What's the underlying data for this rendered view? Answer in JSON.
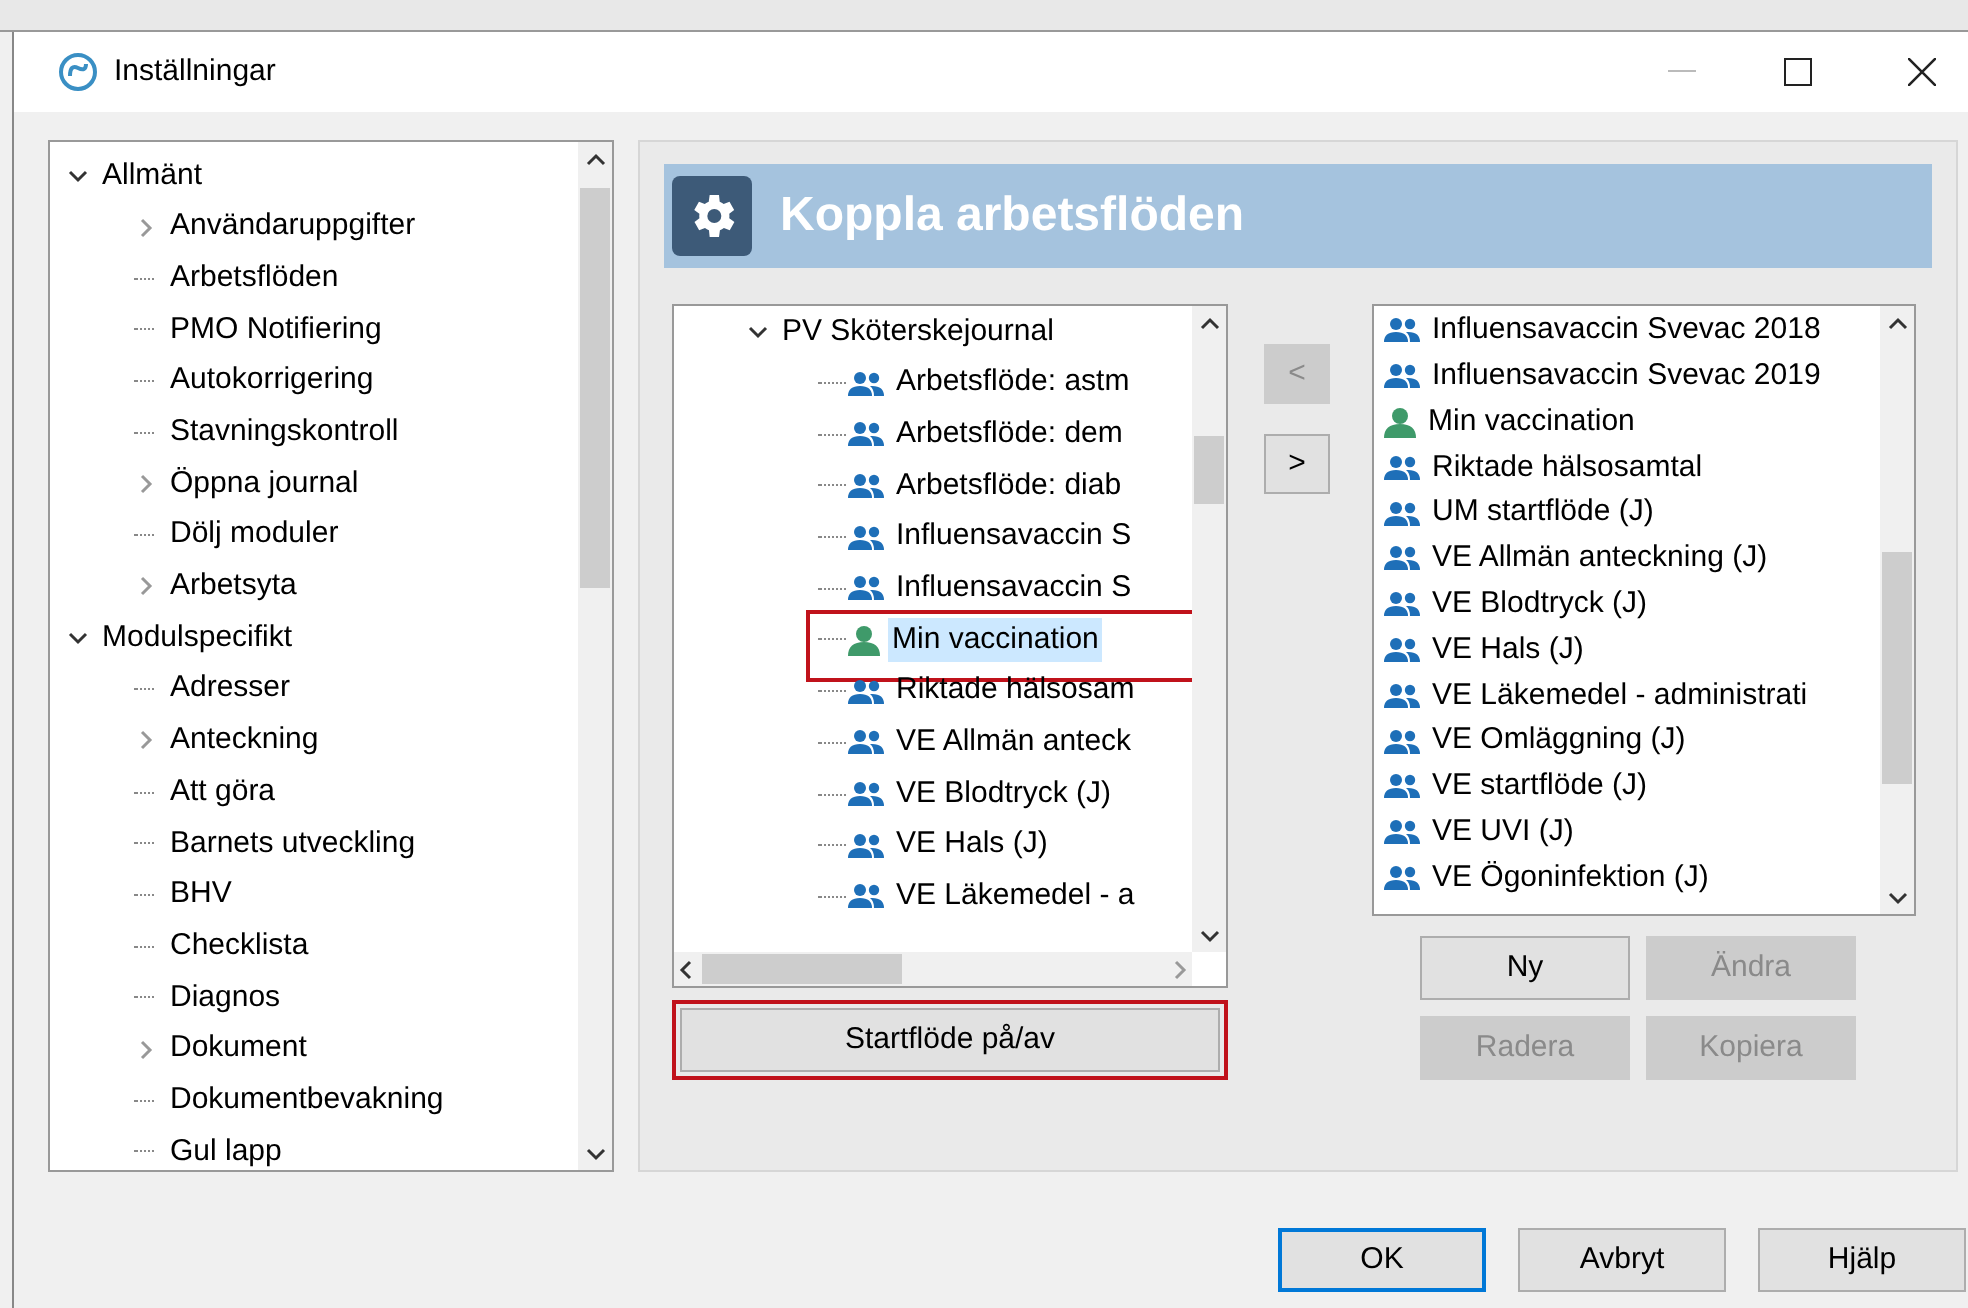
{
  "window": {
    "title": "Inställningar"
  },
  "nav_tree": [
    {
      "label": "Allmänt",
      "expanded": true,
      "children": [
        {
          "label": "Användaruppgifter",
          "expandable": true
        },
        {
          "label": "Arbetsflöden",
          "expandable": false
        },
        {
          "label": "PMO Notifiering",
          "expandable": false
        },
        {
          "label": "Autokorrigering",
          "expandable": false
        },
        {
          "label": "Stavningskontroll",
          "expandable": false
        },
        {
          "label": "Öppna journal",
          "expandable": true
        },
        {
          "label": "Dölj moduler",
          "expandable": false
        },
        {
          "label": "Arbetsyta",
          "expandable": true
        }
      ]
    },
    {
      "label": "Modulspecifikt",
      "expanded": true,
      "children": [
        {
          "label": "Adresser",
          "expandable": false
        },
        {
          "label": "Anteckning",
          "expandable": true
        },
        {
          "label": "Att göra",
          "expandable": false
        },
        {
          "label": "Barnets utveckling",
          "expandable": false
        },
        {
          "label": "BHV",
          "expandable": false
        },
        {
          "label": "Checklista",
          "expandable": false
        },
        {
          "label": "Diagnos",
          "expandable": false
        },
        {
          "label": "Dokument",
          "expandable": true
        },
        {
          "label": "Dokumentbevakning",
          "expandable": false
        },
        {
          "label": "Gul lapp",
          "expandable": false
        }
      ]
    }
  ],
  "panel": {
    "title": "Koppla arbetsflöden",
    "workflow_tree": {
      "label": "PV Sköterskejournal",
      "expanded": true,
      "children": [
        {
          "label": "Arbetsflöde: astm",
          "kind": "group",
          "selected": false,
          "highlighted": false
        },
        {
          "label": "Arbetsflöde: dem",
          "kind": "group",
          "selected": false,
          "highlighted": false
        },
        {
          "label": "Arbetsflöde: diab",
          "kind": "group",
          "selected": false,
          "highlighted": false
        },
        {
          "label": "Influensavaccin S",
          "kind": "group",
          "selected": false,
          "highlighted": false
        },
        {
          "label": "Influensavaccin S",
          "kind": "group",
          "selected": false,
          "highlighted": false
        },
        {
          "label": "Min vaccination",
          "kind": "person",
          "selected": true,
          "highlighted": true
        },
        {
          "label": "Riktade hälsosam",
          "kind": "group",
          "selected": false,
          "highlighted": false
        },
        {
          "label": "VE Allmän anteck",
          "kind": "group",
          "selected": false,
          "highlighted": false
        },
        {
          "label": "VE Blodtryck (J)",
          "kind": "group",
          "selected": false,
          "highlighted": false
        },
        {
          "label": "VE Hals (J)",
          "kind": "group",
          "selected": false,
          "highlighted": false
        },
        {
          "label": "VE Läkemedel - a",
          "kind": "group",
          "selected": false,
          "highlighted": false
        }
      ]
    },
    "toggle_button": {
      "label": "Startflöde på/av",
      "highlighted": true
    },
    "move_buttons": [
      {
        "label": "<",
        "disabled": true
      },
      {
        "label": ">",
        "disabled": false
      }
    ],
    "start_flows": [
      {
        "label": "Influensavaccin Svevac 2018",
        "kind": "group"
      },
      {
        "label": "Influensavaccin Svevac 2019",
        "kind": "group"
      },
      {
        "label": "Min vaccination",
        "kind": "person"
      },
      {
        "label": "Riktade hälsosamtal",
        "kind": "group"
      },
      {
        "label": "UM startflöde (J)",
        "kind": "group"
      },
      {
        "label": "VE Allmän anteckning (J)",
        "kind": "group"
      },
      {
        "label": "VE Blodtryck (J)",
        "kind": "group"
      },
      {
        "label": "VE Hals (J)",
        "kind": "group"
      },
      {
        "label": "VE Läkemedel - administrati",
        "kind": "group"
      },
      {
        "label": "VE Omläggning (J)",
        "kind": "group"
      },
      {
        "label": "VE startflöde (J)",
        "kind": "group"
      },
      {
        "label": "VE UVI (J)",
        "kind": "group"
      },
      {
        "label": "VE Ögoninfektion (J)",
        "kind": "group"
      }
    ],
    "list_buttons": [
      {
        "label": "Ny",
        "disabled": false
      },
      {
        "label": "Ändra",
        "disabled": true
      },
      {
        "label": "Radera",
        "disabled": true
      },
      {
        "label": "Kopiera",
        "disabled": true
      }
    ]
  },
  "dialog_buttons": [
    {
      "label": "OK",
      "default": true
    },
    {
      "label": "Avbryt",
      "default": false
    },
    {
      "label": "Hjälp",
      "default": false
    }
  ]
}
